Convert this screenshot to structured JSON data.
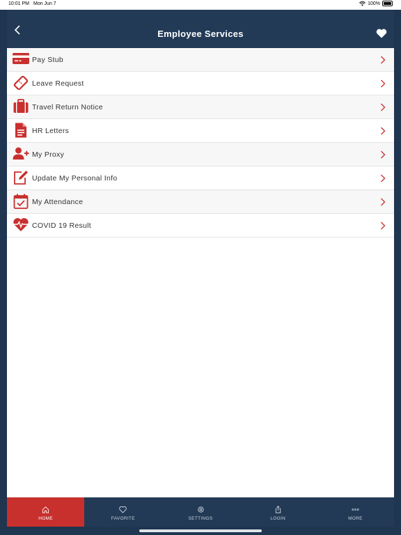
{
  "status": {
    "time": "10:01 PM",
    "date": "Mon Jun 7",
    "battery": "100%"
  },
  "header": {
    "title": "Employee Services"
  },
  "menu": [
    {
      "label": "Pay Stub",
      "icon": "credit-card-icon"
    },
    {
      "label": "Leave Request",
      "icon": "ticket-icon"
    },
    {
      "label": "Travel Return Notice",
      "icon": "suitcase-icon"
    },
    {
      "label": "HR Letters",
      "icon": "document-icon"
    },
    {
      "label": "My Proxy",
      "icon": "add-user-icon"
    },
    {
      "label": "Update My Personal Info",
      "icon": "edit-icon"
    },
    {
      "label": "My Attendance",
      "icon": "calendar-check-icon"
    },
    {
      "label": "COVID 19 Result",
      "icon": "heartbeat-icon"
    }
  ],
  "tabs": [
    {
      "label": "HOME",
      "icon": "home-icon",
      "active": true
    },
    {
      "label": "FAVORITE",
      "icon": "heart-icon"
    },
    {
      "label": "SETTINGS",
      "icon": "gear-icon"
    },
    {
      "label": "LOGIN",
      "icon": "share-icon"
    },
    {
      "label": "MORE",
      "icon": "ellipsis-icon"
    }
  ],
  "colors": {
    "accent": "#c8302e",
    "navy": "#223a56"
  }
}
